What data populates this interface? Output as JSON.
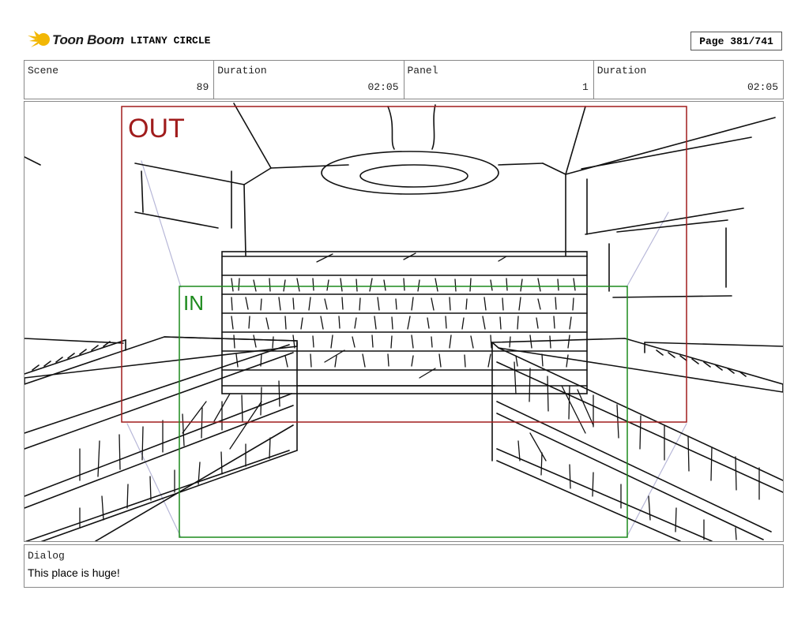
{
  "header": {
    "logo_text": "Toon Boom",
    "project_title": "LITANY CIRCLE",
    "page_label": "Page 381/741"
  },
  "info": {
    "scene_label": "Scene",
    "scene_value": "89",
    "duration_label": "Duration",
    "duration_value": "02:05",
    "panel_label": "Panel",
    "panel_value": "1",
    "panel_duration_label": "Duration",
    "panel_duration_value": "02:05"
  },
  "panel_frames": {
    "out_label": "OUT",
    "in_label": "IN",
    "out_color": "#a01c1c",
    "in_color": "#1c8a1c"
  },
  "dialog": {
    "label": "Dialog",
    "text": "This place is huge!"
  }
}
